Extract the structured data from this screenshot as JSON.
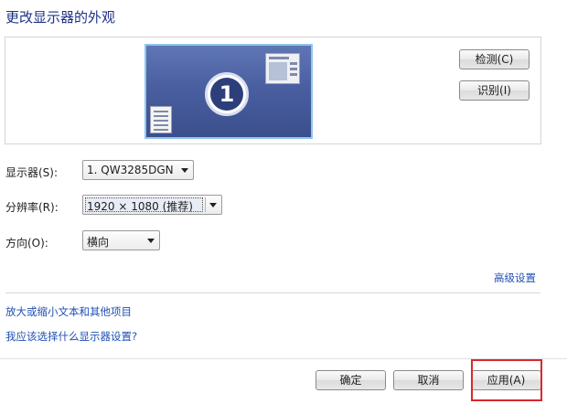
{
  "title": "更改显示器的外观",
  "preview": {
    "monitor_number": "1",
    "detect_button": "检测(C)",
    "identify_button": "识别(I)"
  },
  "display": {
    "label": "显示器(S):",
    "value": "1. QW3285DGN"
  },
  "resolution": {
    "label": "分辨率(R):",
    "value": "1920 × 1080 (推荐)"
  },
  "orientation": {
    "label": "方向(O):",
    "value": "横向"
  },
  "advanced_link": "高级设置",
  "links": {
    "enlarge_text": "放大或缩小文本和其他项目",
    "which_settings": "我应该选择什么显示器设置?"
  },
  "footer": {
    "ok": "确定",
    "cancel": "取消",
    "apply": "应用(A)"
  },
  "colors": {
    "title": "#1e3287",
    "link": "#1f50b4",
    "highlight": "#d9272e",
    "monitor_border": "#8fc6ee"
  }
}
